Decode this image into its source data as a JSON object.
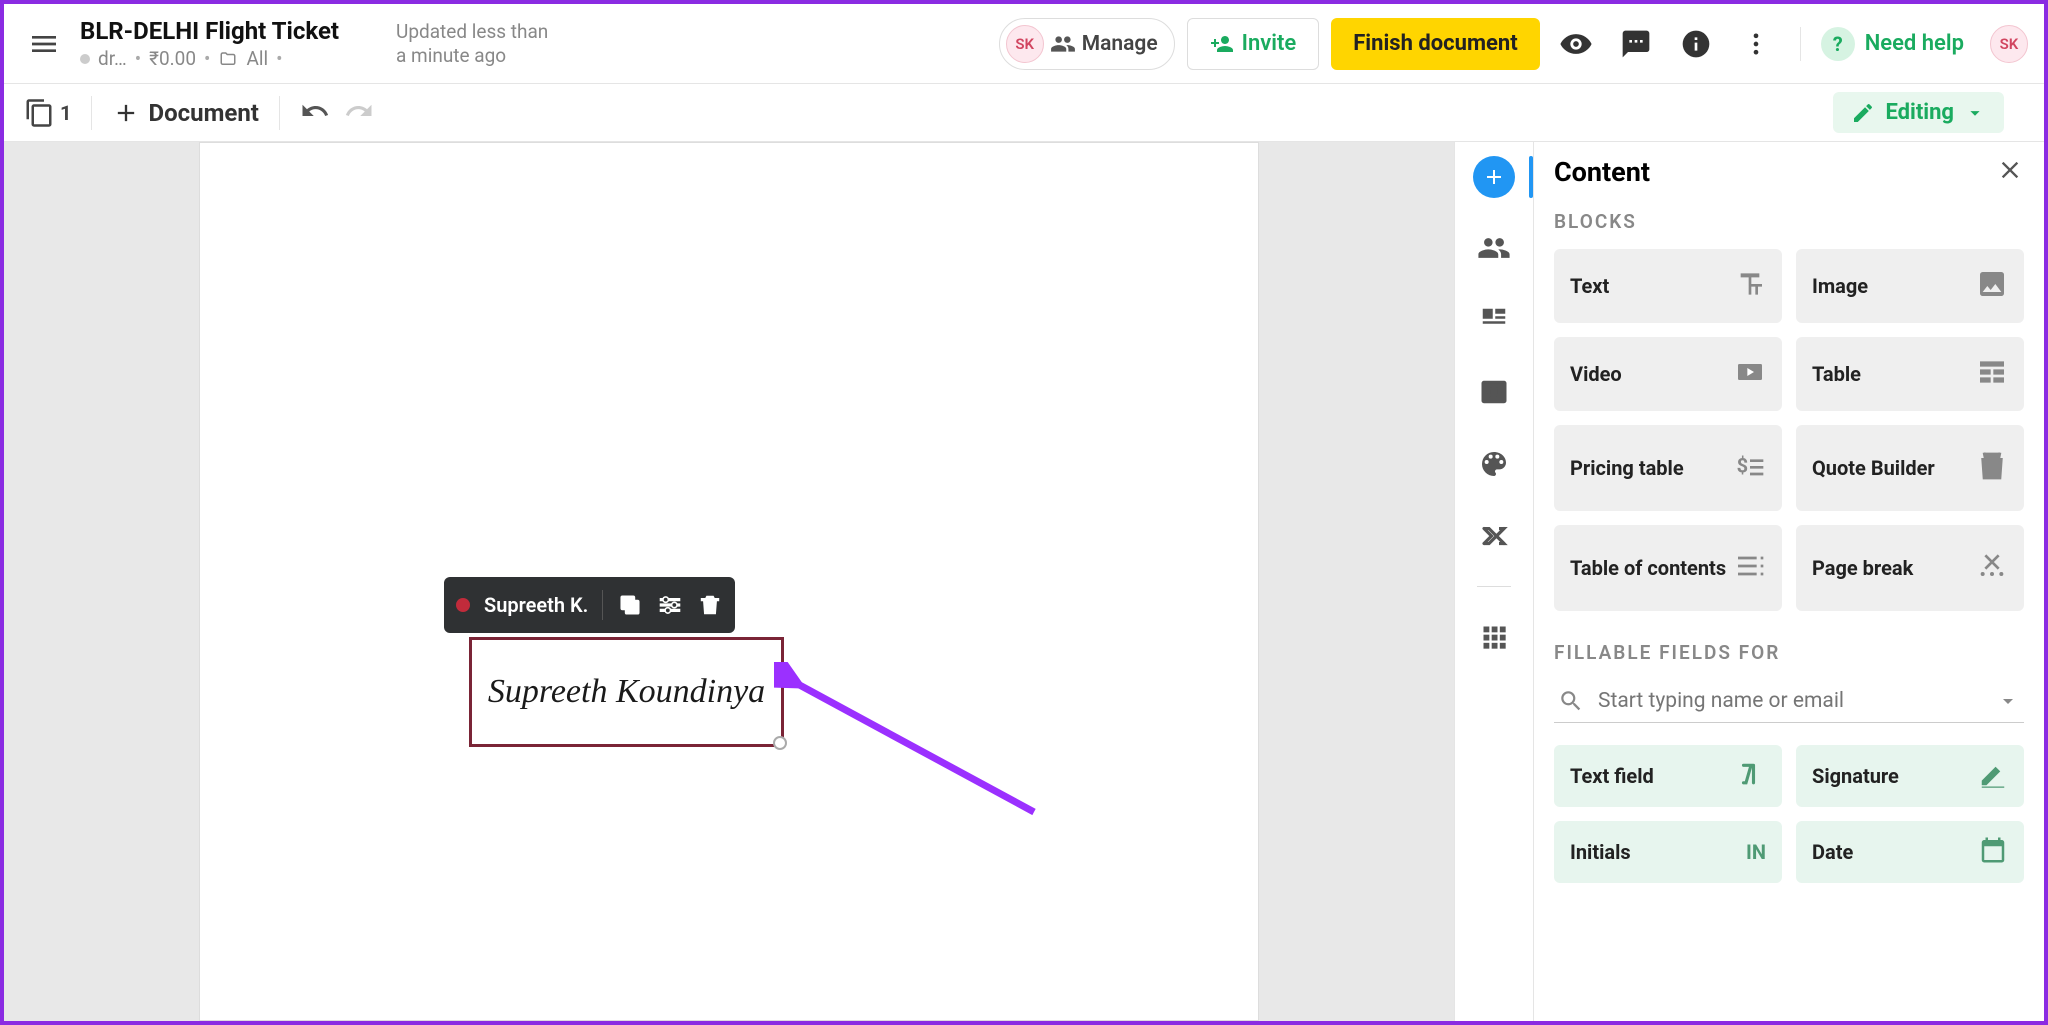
{
  "header": {
    "doc_title": "BLR-DELHI Flight Ticket",
    "status": "dr…",
    "price": "₹0.00",
    "folder": "All",
    "updated": "Updated less than a minute ago",
    "avatar_initials": "SK",
    "manage_label": "Manage",
    "invite_label": "Invite",
    "finish_label": "Finish document",
    "need_help_label": "Need help"
  },
  "subtoolbar": {
    "pages_count": "1",
    "document_label": "Document",
    "editing_label": "Editing"
  },
  "signature": {
    "assignee": "Supreeth K.",
    "value": "Supreeth Koundinya"
  },
  "panel": {
    "title": "Content",
    "blocks_section": "BLOCKS",
    "fillable_section": "FILLABLE FIELDS FOR",
    "search_placeholder": "Start typing name or email",
    "blocks": {
      "text": "Text",
      "image": "Image",
      "video": "Video",
      "table": "Table",
      "pricing_table": "Pricing table",
      "quote_builder": "Quote Builder",
      "toc": "Table of contents",
      "page_break": "Page break"
    },
    "fields": {
      "text_field": "Text field",
      "signature": "Signature",
      "initials": "Initials",
      "initials_icon_text": "IN",
      "date": "Date"
    }
  }
}
